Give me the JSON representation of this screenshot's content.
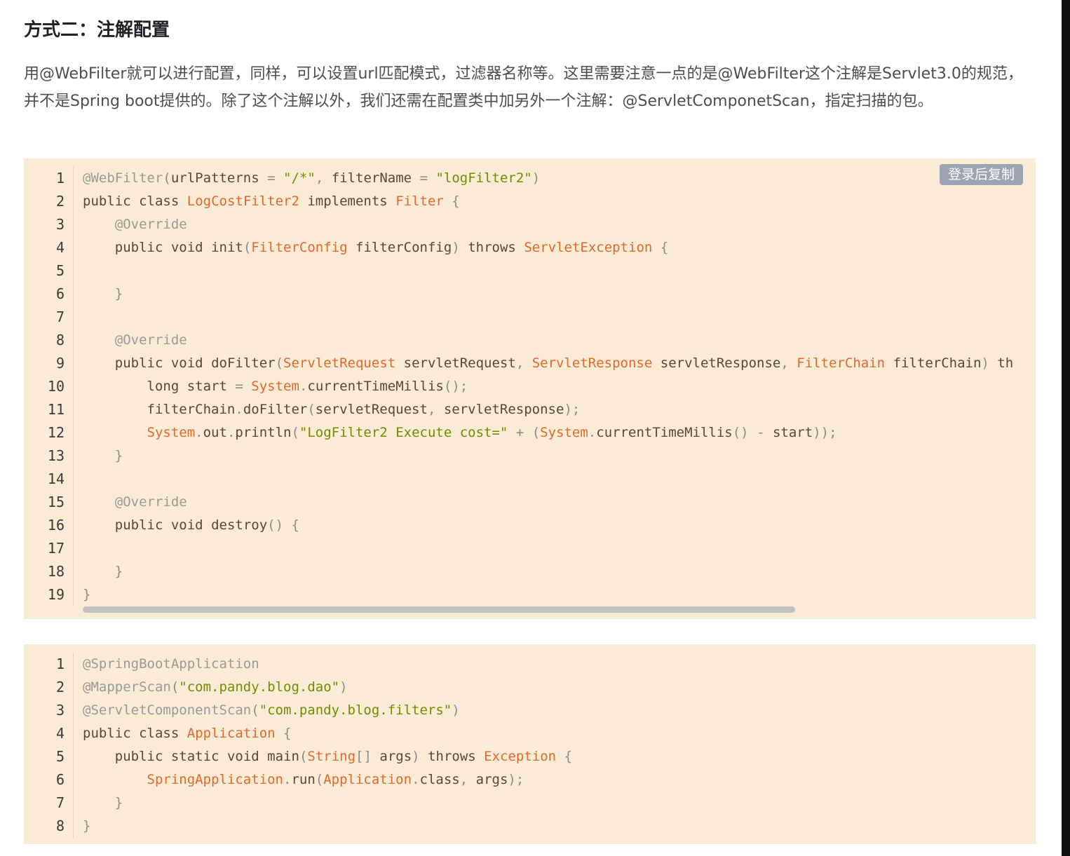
{
  "heading": "方式二：注解配置",
  "paragraph": "用@WebFilter就可以进行配置，同样，可以设置url匹配模式，过滤器名称等。这里需要注意一点的是@WebFilter这个注解是Servlet3.0的规范，并不是Spring boot提供的。除了这个注解以外，我们还需在配置类中加另外一个注解：@ServletComponetScan，指定扫描的包。",
  "copy_label": "登录后复制",
  "code_block_1": {
    "line_numbers": [
      "1",
      "2",
      "3",
      "4",
      "5",
      "6",
      "7",
      "8",
      "9",
      "10",
      "11",
      "12",
      "13",
      "14",
      "15",
      "16",
      "17",
      "18",
      "19"
    ],
    "lines": [
      "@WebFilter(urlPatterns = \"/*\", filterName = \"logFilter2\")",
      "public class LogCostFilter2 implements Filter {",
      "    @Override",
      "    public void init(FilterConfig filterConfig) throws ServletException {",
      "",
      "    }",
      "",
      "    @Override",
      "    public void doFilter(ServletRequest servletRequest, ServletResponse servletResponse, FilterChain filterChain) th",
      "        long start = System.currentTimeMillis();",
      "        filterChain.doFilter(servletRequest, servletResponse);",
      "        System.out.println(\"LogFilter2 Execute cost=\" + (System.currentTimeMillis() - start));",
      "    }",
      "",
      "    @Override",
      "    public void destroy() {",
      "",
      "    }",
      "}"
    ]
  },
  "code_block_2": {
    "line_numbers": [
      "1",
      "2",
      "3",
      "4",
      "5",
      "6",
      "7",
      "8"
    ],
    "lines": [
      "@SpringBootApplication",
      "@MapperScan(\"com.pandy.blog.dao\")",
      "@ServletComponentScan(\"com.pandy.blog.filters\")",
      "public class Application {",
      "    public static void main(String[] args) throws Exception {",
      "        SpringApplication.run(Application.class, args);",
      "    }",
      "}"
    ]
  },
  "colors": {
    "code_background": "#faebd7",
    "annotation": "#999999",
    "type": "#e0692b",
    "string": "#718c00",
    "copy_button": "#9ea3b3"
  }
}
